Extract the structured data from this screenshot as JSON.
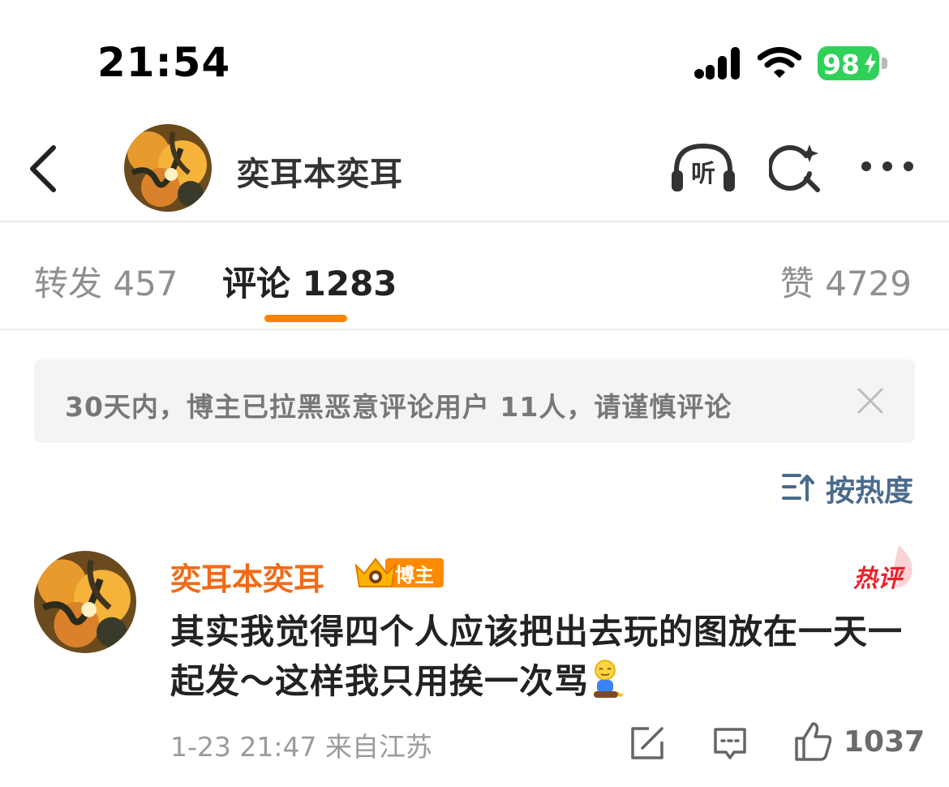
{
  "status_bar": {
    "time": "21:54",
    "battery_level": "98",
    "battery_color": "#30d158"
  },
  "nav": {
    "title": "奕耳本奕耳",
    "listen_label": "听",
    "icons": [
      "back-arrow-icon",
      "headphones-icon",
      "search-sparkle-icon",
      "more-dots-icon"
    ]
  },
  "tabs": {
    "forward": "转发 457",
    "comment": "评论 1283",
    "like": "赞 4729",
    "active": "comment",
    "accent_color": "#ff8200"
  },
  "notice": {
    "text": "30天内，博主已拉黑恶意评论用户 11人，请谨慎评论"
  },
  "sort": {
    "label": "按热度"
  },
  "comment": {
    "username": "奕耳本奕耳",
    "badge": "博主",
    "hot_label": "热评",
    "text": "其实我觉得四个人应该把出去玩的图放在一天一起发～这样我只用挨一次骂",
    "meta": "1-23 21:47  来自江苏",
    "likes": "1037",
    "username_color": "#f06b17"
  }
}
